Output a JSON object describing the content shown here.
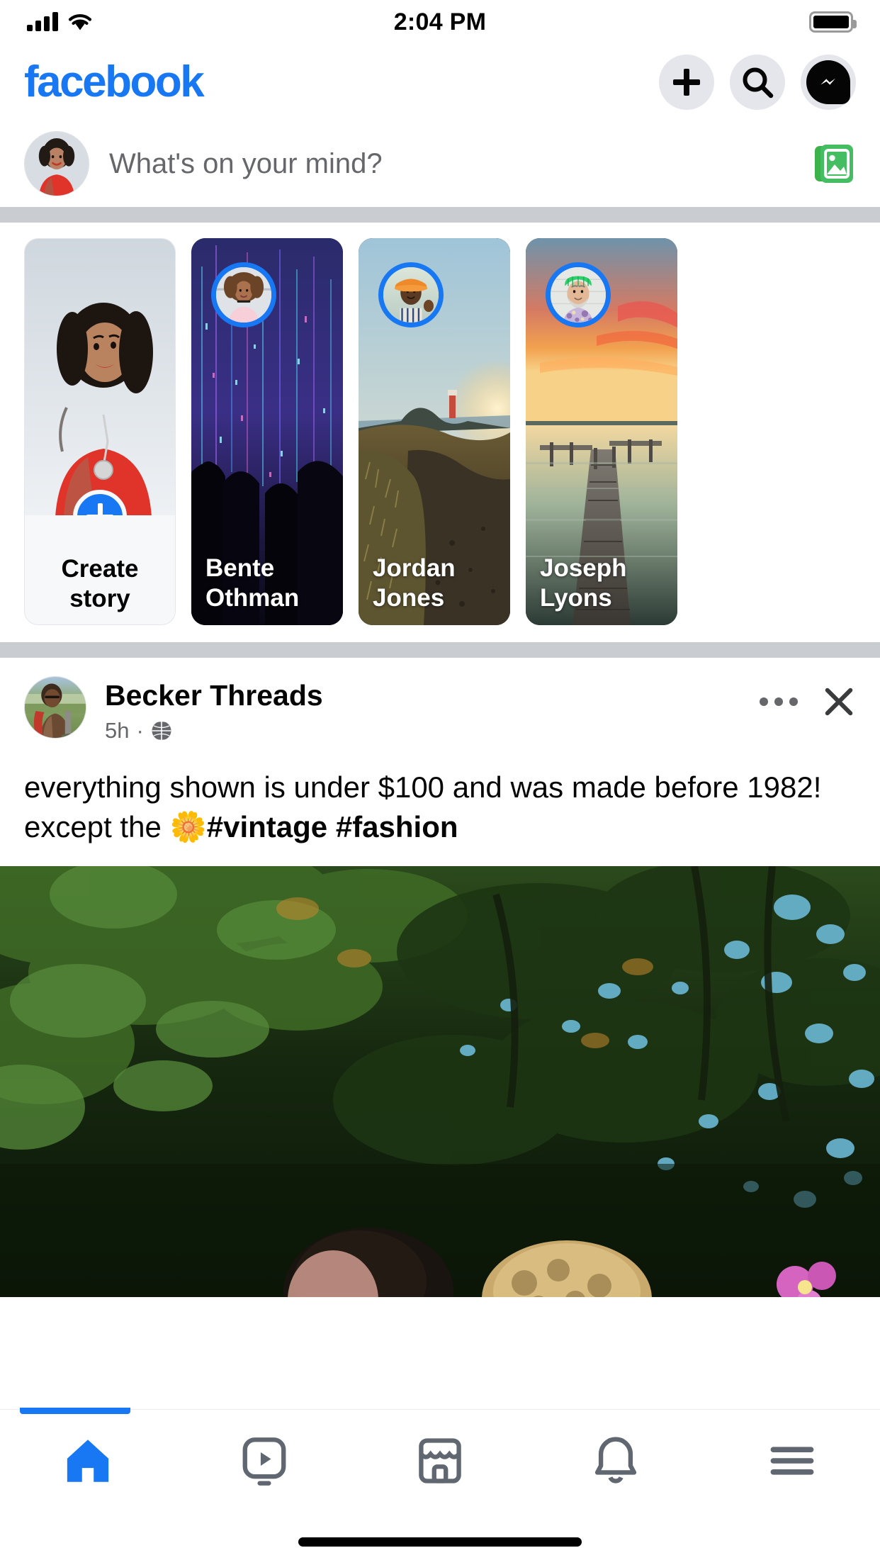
{
  "status_bar": {
    "time": "2:04 PM",
    "signal_icon": "cellular-signal-icon",
    "wifi_icon": "wifi-icon",
    "battery_icon": "battery-full-icon"
  },
  "header": {
    "logo_text": "facebook",
    "logo_color": "#1877F2",
    "actions": [
      {
        "name": "create-button",
        "icon": "plus-icon"
      },
      {
        "name": "search-button",
        "icon": "search-icon"
      },
      {
        "name": "messenger-button",
        "icon": "messenger-icon"
      }
    ]
  },
  "composer": {
    "placeholder": "What's on your mind?",
    "avatar_icon": "user-avatar",
    "photo_button_icon": "photo-gallery-icon",
    "photo_button_color": "#45BD62"
  },
  "stories": {
    "create_story": {
      "label_line1": "Create",
      "label_line2": "story",
      "plus_icon": "plus-icon",
      "accent": "#1877F2"
    },
    "items": [
      {
        "name_line1": "Bente",
        "name_line2": "Othman",
        "ring_color": "#1877F2"
      },
      {
        "name_line1": "Jordan",
        "name_line2": "Jones",
        "ring_color": "#1877F2"
      },
      {
        "name_line1": "Joseph",
        "name_line2": "Lyons",
        "ring_color": "#1877F2"
      }
    ]
  },
  "post": {
    "author": "Becker Threads",
    "timestamp": "5h",
    "separator": "·",
    "audience_icon": "globe-public-icon",
    "menu_icon": "more-options-icon",
    "close_icon": "close-icon",
    "text_part1": "everything shown is under $100 and was made before 1982! except the ",
    "emoji": "🌼",
    "text_hashtags": "#vintage #fashion",
    "image_alt": "forest-canopy-photo"
  },
  "bottom_nav": {
    "active_index": 0,
    "active_color": "#1877F2",
    "inactive_color": "#606770",
    "items": [
      {
        "name": "nav-home",
        "icon": "home-icon"
      },
      {
        "name": "nav-video",
        "icon": "video-watch-icon"
      },
      {
        "name": "nav-marketplace",
        "icon": "marketplace-store-icon"
      },
      {
        "name": "nav-notifications",
        "icon": "bell-notification-icon"
      },
      {
        "name": "nav-menu",
        "icon": "hamburger-menu-icon"
      }
    ]
  }
}
